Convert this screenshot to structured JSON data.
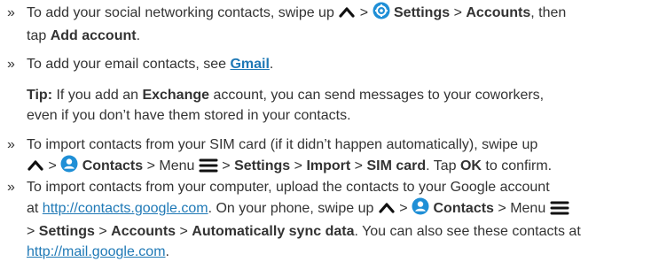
{
  "items": [
    {
      "l1a": "To add your social networking contacts, swipe up",
      "sep1": " > ",
      "settings": "Settings",
      "sep2": " > ",
      "accounts": "Accounts",
      "l1b": ", then",
      "l2a": "tap ",
      "add_account": "Add account",
      "l2b": "."
    },
    {
      "t1": "To add your email contacts, see ",
      "gmail": "Gmail",
      "t2": "."
    },
    {
      "tip_label": "Tip:",
      "t1": " If you add an ",
      "exchange": "Exchange",
      "t2": " account, you can send messages to your coworkers,",
      "l2": "even if you don’t have them stored in your contacts."
    },
    {
      "l1": "To import contacts from your SIM card (if it didn’t happen automatically), swipe up",
      "sep1": " > ",
      "contacts": "Contacts",
      "sep2": " > Menu ",
      "sep3": " > ",
      "settings": "Settings",
      "sep4": " > ",
      "import": "Import",
      "sep5": " > ",
      "sim_card": "SIM card",
      "t1": ". Tap ",
      "ok": "OK",
      "t2": " to confirm."
    },
    {
      "l1": "To import contacts from your computer, upload the contacts to your Google account",
      "l2a": "at ",
      "url1": "http://contacts.google.com",
      "l2b": ". On your phone, swipe up",
      "sep1": " > ",
      "contacts": "Contacts",
      "sep2": " > Menu ",
      "l3a": "> ",
      "settings": "Settings",
      "sep3": " > ",
      "accounts": "Accounts",
      "sep4": " > ",
      "sync": "Automatically sync data",
      "l3b": ". You can also see these contacts at",
      "url2": "http://mail.google.com",
      "l4b": "."
    }
  ],
  "bullet": "»",
  "colors": {
    "text": "#333333",
    "link": "#1f79b6",
    "icon": "#1f8fd6"
  },
  "icons": [
    "chevron-up-icon",
    "settings-gear-icon",
    "contacts-person-icon",
    "menu-hamburger-icon"
  ]
}
